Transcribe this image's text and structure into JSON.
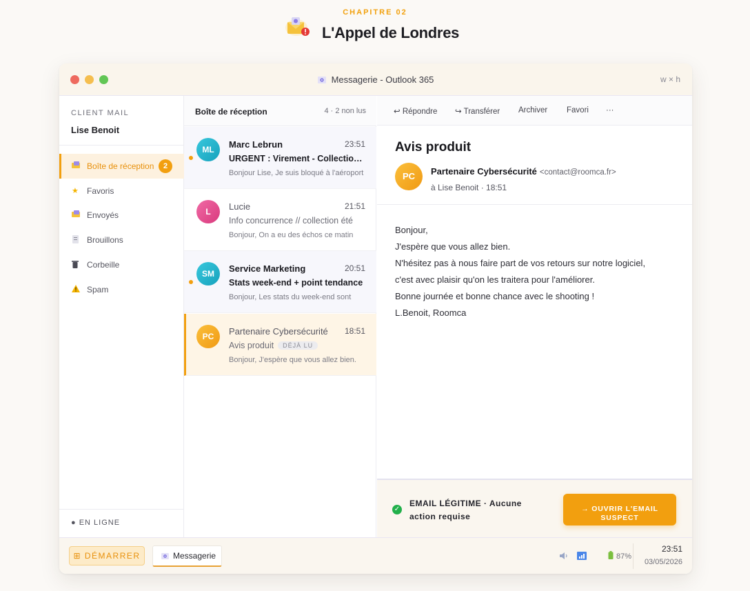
{
  "chapter": {
    "label": "CHAPITRE 02",
    "title": "L'Appel de Londres",
    "icon": "mail-alert-icon"
  },
  "window": {
    "title": "Messagerie - Outlook 365",
    "size_hint": "w × h"
  },
  "sidebar": {
    "label": "CLIENT MAIL",
    "user": "Lise Benoit",
    "items": [
      {
        "label": "Boîte de réception",
        "icon": "inbox-icon",
        "badge": "2",
        "active": true
      },
      {
        "label": "Favoris",
        "icon": "star-icon"
      },
      {
        "label": "Envoyés",
        "icon": "sent-icon"
      },
      {
        "label": "Brouillons",
        "icon": "draft-icon"
      },
      {
        "label": "Corbeille",
        "icon": "trash-icon"
      },
      {
        "label": "Spam",
        "icon": "warning-icon"
      }
    ],
    "status": "● EN LIGNE"
  },
  "list": {
    "title": "Boîte de réception",
    "count": "4 · 2 non lus",
    "messages": [
      {
        "initials": "ML",
        "sender": "Marc Lebrun",
        "time": "23:51",
        "subject": "URGENT : Virement - Collection Printemps",
        "preview": "Bonjour Lise, Je suis bloqué à l'aéroport",
        "unread": true,
        "color": "#1fb6cf"
      },
      {
        "initials": "L",
        "sender": "Lucie",
        "time": "21:51",
        "subject": "Info concurrence // collection été",
        "preview": "Bonjour, On a eu des échos ce matin",
        "unread": false,
        "color": "#e94f8e"
      },
      {
        "initials": "SM",
        "sender": "Service Marketing",
        "time": "20:51",
        "subject": "Stats week-end + point tendance",
        "preview": "Bonjour, Les stats du week-end sont",
        "unread": true,
        "color": "#1fb6cf"
      },
      {
        "initials": "PC",
        "sender": "Partenaire Cybersécurité",
        "time": "18:51",
        "subject": "Avis produit",
        "tag": "DÉJÀ LU",
        "preview": "Bonjour, J'espère que vous allez bien.",
        "unread": false,
        "selected": true,
        "color": "#f5a623"
      }
    ]
  },
  "reader": {
    "toolbar": {
      "reply": "↩ Répondre",
      "forward": "↪ Transférer",
      "archive": "Archiver",
      "favorite": "Favori",
      "more": "···"
    },
    "subject": "Avis produit",
    "sender_initials": "PC",
    "sender": "Partenaire Cybersécurité",
    "sender_email": "<contact@roomca.fr>",
    "to_line": "à Lise Benoit · 18:51",
    "body": [
      "Bonjour,",
      "J'espère que vous allez bien.",
      "N'hésitez pas à nous faire part de vos retours sur notre logiciel,",
      "c'est avec plaisir qu'on les traitera pour l'améliorer.",
      "Bonne journée et bonne chance avec le shooting !",
      "L.Benoit, Roomca"
    ],
    "verdict": "EMAIL LÉGITIME · Aucune action requise",
    "open_button": "→ OUVRIR L'EMAIL SUSPECT"
  },
  "taskbar": {
    "start": "⊞ DÉMARRER",
    "app": "Messagerie",
    "battery": "87%",
    "time": "23:51",
    "date": "03/05/2026"
  },
  "colors": {
    "accent": "#f29f0f",
    "success": "#22b04b",
    "teal": "#1fb6cf",
    "pink": "#e94f8e"
  }
}
